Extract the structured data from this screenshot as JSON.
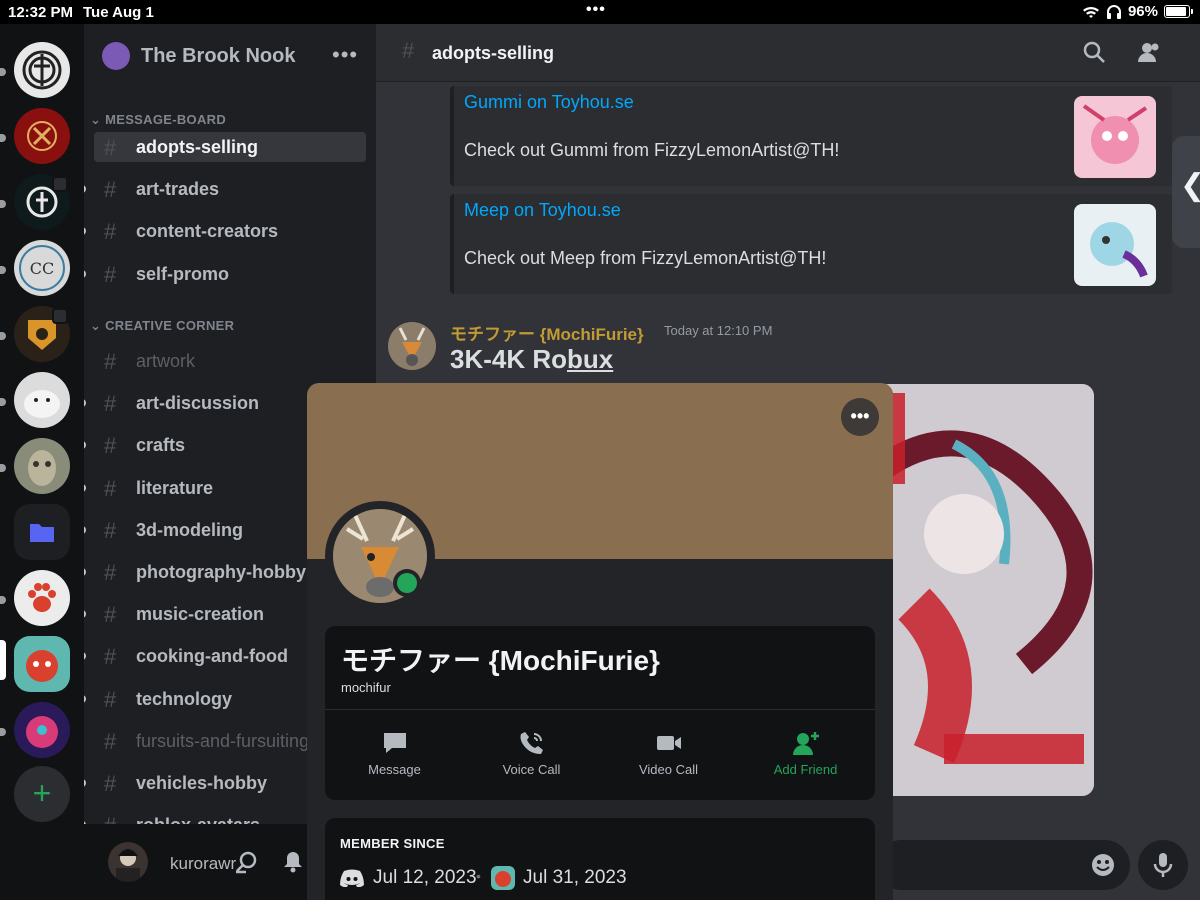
{
  "status_bar": {
    "time": "12:32 PM",
    "date": "Tue Aug 1",
    "dots": "•••",
    "battery": "96%",
    "battery_level": 0.96
  },
  "guild": {
    "name": "The Brook Nook",
    "more": "•••"
  },
  "channel_list": {
    "categories": [
      {
        "name": "MESSAGE-BOARD"
      },
      {
        "name": "CREATIVE CORNER"
      }
    ],
    "channels": [
      {
        "name": "adopts-selling",
        "active": true,
        "unread": false,
        "muted": false
      },
      {
        "name": "art-trades",
        "active": false,
        "unread": true,
        "muted": false
      },
      {
        "name": "content-creators",
        "active": false,
        "unread": true,
        "muted": false
      },
      {
        "name": "self-promo",
        "active": false,
        "unread": true,
        "muted": false
      },
      {
        "name": "artwork",
        "active": false,
        "unread": false,
        "muted": true
      },
      {
        "name": "art-discussion",
        "active": false,
        "unread": true,
        "muted": false
      },
      {
        "name": "crafts",
        "active": false,
        "unread": true,
        "muted": false
      },
      {
        "name": "literature",
        "active": false,
        "unread": true,
        "muted": false
      },
      {
        "name": "3d-modeling",
        "active": false,
        "unread": true,
        "muted": false
      },
      {
        "name": "photography-hobby",
        "active": false,
        "unread": true,
        "muted": false
      },
      {
        "name": "music-creation",
        "active": false,
        "unread": true,
        "muted": false
      },
      {
        "name": "cooking-and-food",
        "active": false,
        "unread": true,
        "muted": false
      },
      {
        "name": "technology",
        "active": false,
        "unread": true,
        "muted": false
      },
      {
        "name": "fursuits-and-fursuiting",
        "active": false,
        "unread": false,
        "muted": true
      },
      {
        "name": "vehicles-hobby",
        "active": false,
        "unread": true,
        "muted": false
      },
      {
        "name": "roblox-avatars",
        "active": false,
        "unread": true,
        "muted": false
      }
    ]
  },
  "user_bar": {
    "username": "kurorawr"
  },
  "chat": {
    "channel_name": "adopts-selling",
    "embeds": [
      {
        "title": "Gummi on Toyhou.se",
        "description": "Check out Gummi from FizzyLemonArtist@TH!"
      },
      {
        "title": "Meep on Toyhou.se",
        "description": "Check out Meep from FizzyLemonArtist@TH!"
      }
    ],
    "message": {
      "author": "モチファー {MochiFurie}",
      "timestamp": "Today at 12:10 PM",
      "body_prefix": "3K-4K Ro",
      "body_underlined": "bux"
    }
  },
  "profile": {
    "display_name": "モチファー {MochiFurie}",
    "username": "mochifur",
    "more": "•••",
    "actions": [
      {
        "label": "Message"
      },
      {
        "label": "Voice Call"
      },
      {
        "label": "Video Call"
      },
      {
        "label": "Add Friend"
      }
    ],
    "member_since_label": "MEMBER SINCE",
    "discord_since": "Jul 12, 2023",
    "server_since": "Jul 31, 2023"
  },
  "colors": {
    "accent_link": "#00a8fc",
    "online": "#23a55a",
    "author": "#c29b35",
    "banner": "#8a6e50"
  }
}
